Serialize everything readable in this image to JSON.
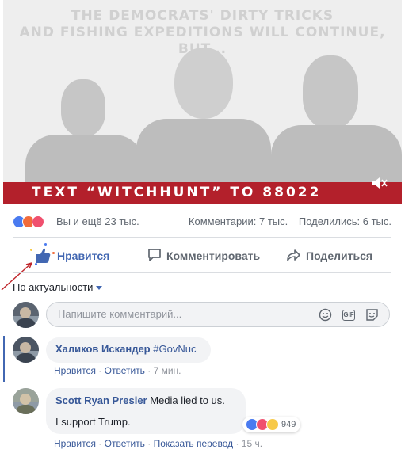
{
  "media": {
    "headline": [
      "THE DEMOCRATS' DIRTY TRICKS",
      "AND FISHING EXPEDITIONS WILL CONTINUE,",
      "BUT..."
    ],
    "banner": "TEXT “WITCHHUNT” TO 88022",
    "mute_icon": "speaker-muted-icon"
  },
  "summary": {
    "reactions": [
      "like",
      "angry",
      "love"
    ],
    "who": "Вы и ещё 23 тыс.",
    "comments": "Комментарии: 7 тыс.",
    "shares": "Поделились: 6 тыс."
  },
  "actions": {
    "like": "Нравится",
    "comment": "Комментировать",
    "share": "Поделиться"
  },
  "sort": {
    "label": "По актуальности"
  },
  "composer": {
    "placeholder": "Напишите комментарий...",
    "icons": [
      "emoji-icon",
      "gif-icon",
      "sticker-icon"
    ]
  },
  "comments": [
    {
      "author": "Халиков Искандер",
      "text": "#GovNuc",
      "actions": [
        "Нравится",
        "Ответить"
      ],
      "time": "7 мин."
    },
    {
      "author": "Scott Ryan Presler",
      "text_line1": "Media lied to us.",
      "text_line2": "I support Trump.",
      "reaction_count": "949",
      "actions": [
        "Нравится",
        "Ответить",
        "Показать перевод"
      ],
      "time": "15 ч."
    }
  ],
  "colors": {
    "link": "#385898",
    "like_active": "#4267b2",
    "banner": "#b3202b",
    "reaction_like": "#4a7bf0",
    "reaction_angry": "#f26b3a",
    "reaction_love": "#f0506e",
    "reaction_haha": "#f7c948"
  }
}
